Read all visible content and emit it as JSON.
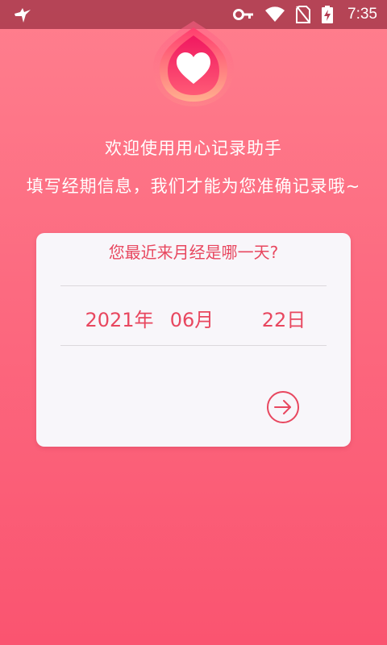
{
  "status_bar": {
    "time": "7:35",
    "icons": [
      "bird-icon",
      "key-icon",
      "wifi-icon",
      "no-sim-icon",
      "battery-charging-icon"
    ]
  },
  "welcome": {
    "title": "欢迎使用用心记录助手",
    "subtitle": "填写经期信息，我们才能为您准确记录哦~"
  },
  "card": {
    "question": "您最近来月经是哪一天?",
    "date_picker": {
      "year": "2021年",
      "month": "06月",
      "day": "22日"
    },
    "next_icon": "arrow-right-circle-icon"
  },
  "colors": {
    "accent": "#e8475f",
    "background_top": "#ff7f8e",
    "background_bottom": "#fa5470",
    "card_background": "#f8f6fa"
  }
}
